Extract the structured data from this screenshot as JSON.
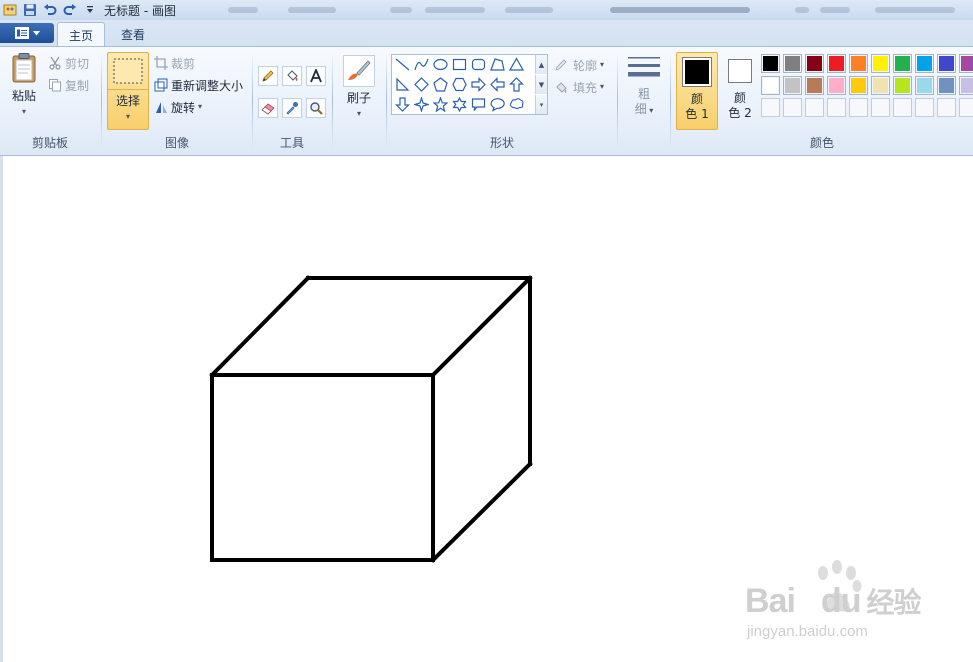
{
  "titlebar": {
    "title": "无标题 - 画图"
  },
  "menu": {
    "tabs": [
      {
        "label": "主页",
        "active": true
      },
      {
        "label": "查看",
        "active": false
      }
    ]
  },
  "clipboard": {
    "paste": "粘贴",
    "cut": "剪切",
    "copy": "复制",
    "group": "剪贴板"
  },
  "image": {
    "select": "选择",
    "crop": "裁剪",
    "resize": "重新调整大小",
    "rotate": "旋转",
    "group": "图像"
  },
  "tools": {
    "group": "工具",
    "items": [
      "pencil-icon",
      "fill-bucket-icon",
      "text-icon",
      "eraser-icon",
      "color-picker-icon",
      "magnifier-icon"
    ]
  },
  "brushes": {
    "label": "刷子"
  },
  "shapes": {
    "outline": "轮廓",
    "fill": "填充",
    "group": "形状"
  },
  "size": {
    "label_line1": "粗",
    "label_line2": "细"
  },
  "colors": {
    "color1_line1": "颜",
    "color1_line2": "色 1",
    "color2_line1": "颜",
    "color2_line2": "色 2",
    "group": "颜色",
    "color1": "#000000",
    "color2": "#ffffff",
    "palette_row1": [
      "#000000",
      "#7f7f7f",
      "#880015",
      "#ed1c24",
      "#ff7f27",
      "#fff200",
      "#22b14c",
      "#00a2e8",
      "#3f48cc",
      "#a349a4"
    ],
    "palette_row2": [
      "#ffffff",
      "#c3c3c3",
      "#b97a57",
      "#ffaec9",
      "#ffc90e",
      "#efe4b0",
      "#b5e61d",
      "#99d9ea",
      "#7092be",
      "#c8bfe7"
    ],
    "palette_row3_empty": 10
  },
  "canvas": {
    "drawing": "cube-outline",
    "stroke_color": "#000000"
  },
  "watermark": {
    "brand": "Bai",
    "brand2": "du",
    "product": "经验",
    "url": "jingyan.baidu.com"
  }
}
